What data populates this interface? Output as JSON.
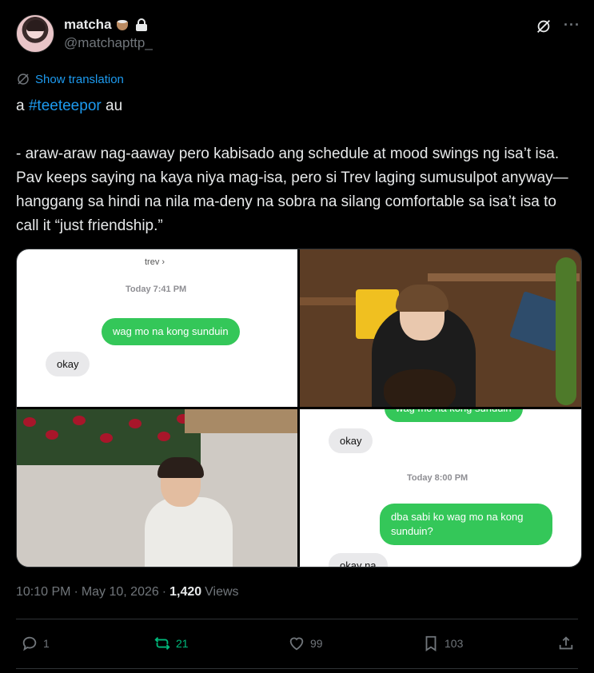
{
  "author": {
    "display_name": "matcha",
    "handle": "@matchapttp_",
    "emoji": "coffee-cup-icon",
    "protected": true
  },
  "translate_label": "Show translation",
  "tweet": {
    "prefix": "a ",
    "hashtag": "#teeteepor",
    "suffix": " au",
    "body": "- araw-araw nag-aaway pero kabisado ang schedule at mood swings ng isa’t isa. Pav keeps saying na kaya niya mag-isa, pero si Trev laging sumusulpot anyway—hanggang sa hindi na nila ma-deny na sobra na silang comfortable sa isa’t isa to call it “just friendship.”"
  },
  "media": {
    "chat1": {
      "contact": "trev ›",
      "time": "Today 7:41 PM",
      "sent": "wag mo na kong sunduin",
      "received": "okay"
    },
    "chat2": {
      "top_cut": "wag mo na kong sunduin",
      "received": "okay",
      "time": "Today 8:00 PM",
      "sent": "dba sabi ko wag mo na kong sunduin?",
      "bottom_cut": "okay na"
    }
  },
  "meta": {
    "time": "10:10 PM",
    "date": "May 10, 2026",
    "views_count": "1,420",
    "views_label": "Views"
  },
  "actions": {
    "replies": "1",
    "reposts": "21",
    "likes": "99",
    "bookmarks": "103"
  },
  "colors": {
    "background": "#000000",
    "text": "#e7e9ea",
    "muted": "#71767b",
    "accent": "#1d9bf0",
    "repost": "#00ba7c",
    "imessage_green": "#34c759"
  }
}
